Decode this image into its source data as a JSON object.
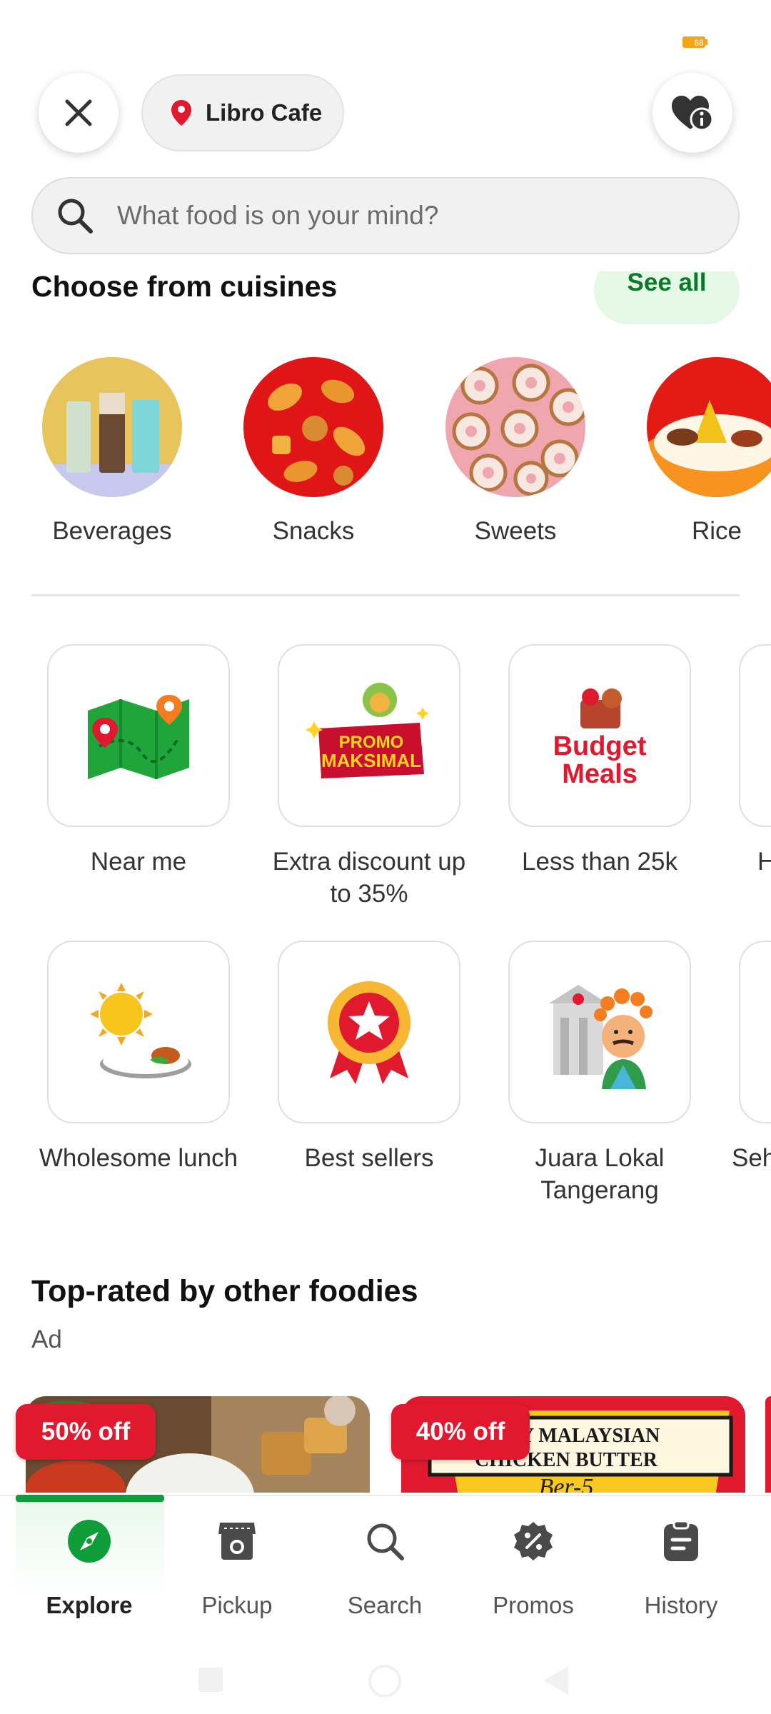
{
  "status_bar": {
    "battery": "68"
  },
  "header": {
    "location_label": "Libro Cafe",
    "search_placeholder": "What food is on your mind?"
  },
  "cuisines": {
    "title": "Choose from cuisines",
    "see_all": "See all",
    "items": [
      {
        "label": "Beverages"
      },
      {
        "label": "Snacks"
      },
      {
        "label": "Sweets"
      },
      {
        "label": "Rice"
      }
    ]
  },
  "shortcuts_row1": [
    {
      "label": "Near me"
    },
    {
      "label": "Extra discount up to 35%",
      "art_text_top": "PROMO",
      "art_text_bottom": "MAKSIMAL"
    },
    {
      "label": "Less than 25k",
      "art_text_top": "Budget",
      "art_text_bottom": "Meals"
    },
    {
      "label": "H"
    }
  ],
  "shortcuts_row2": [
    {
      "label": "Wholesome lunch"
    },
    {
      "label": "Best sellers"
    },
    {
      "label": "Juara Lokal Tangerang"
    },
    {
      "label": "Seh"
    }
  ],
  "top_rated": {
    "title": "Top-rated by other foodies",
    "ad_label": "Ad",
    "cards": [
      {
        "discount": "50% off"
      },
      {
        "discount": "40% off",
        "banner_line1": "MY MALAYSIAN",
        "banner_line2": "CHICKEN BUTTER",
        "banner_line3": "Ber-5"
      }
    ]
  },
  "bottom_nav": {
    "items": [
      {
        "label": "Explore",
        "icon": "compass-icon",
        "active": true
      },
      {
        "label": "Pickup",
        "icon": "store-icon",
        "active": false
      },
      {
        "label": "Search",
        "icon": "search-icon",
        "active": false
      },
      {
        "label": "Promos",
        "icon": "percent-badge-icon",
        "active": false
      },
      {
        "label": "History",
        "icon": "clipboard-icon",
        "active": false
      }
    ]
  },
  "colors": {
    "brand_green": "#0f9d3a",
    "promo_red": "#e0192e",
    "see_all_bg": "#e5f8e5"
  }
}
